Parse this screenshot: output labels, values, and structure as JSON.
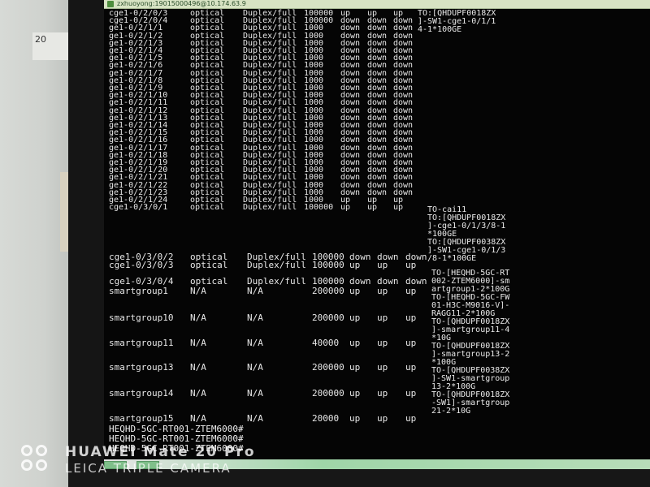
{
  "wall_note": "20",
  "window": {
    "title": "zxhuoyong:19015000496@10.174.63.9"
  },
  "terminal": {
    "rows": [
      {
        "port": "cge1-0/2/0/3",
        "type": "optical",
        "duplex": "Duplex/full",
        "speed": "100000",
        "admin": "up",
        "phy": "up",
        "proto": "up"
      },
      {
        "port": "cge1-0/2/0/4",
        "type": "optical",
        "duplex": "Duplex/full",
        "speed": "100000",
        "admin": "down",
        "phy": "down",
        "proto": "down"
      },
      {
        "port": "ge1-0/2/1/1",
        "type": "optical",
        "duplex": "Duplex/full",
        "speed": "1000",
        "admin": "down",
        "phy": "down",
        "proto": "down"
      },
      {
        "port": "ge1-0/2/1/2",
        "type": "optical",
        "duplex": "Duplex/full",
        "speed": "1000",
        "admin": "down",
        "phy": "down",
        "proto": "down"
      },
      {
        "port": "ge1-0/2/1/3",
        "type": "optical",
        "duplex": "Duplex/full",
        "speed": "1000",
        "admin": "down",
        "phy": "down",
        "proto": "down"
      },
      {
        "port": "ge1-0/2/1/4",
        "type": "optical",
        "duplex": "Duplex/full",
        "speed": "1000",
        "admin": "down",
        "phy": "down",
        "proto": "down"
      },
      {
        "port": "ge1-0/2/1/5",
        "type": "optical",
        "duplex": "Duplex/full",
        "speed": "1000",
        "admin": "down",
        "phy": "down",
        "proto": "down"
      },
      {
        "port": "ge1-0/2/1/6",
        "type": "optical",
        "duplex": "Duplex/full",
        "speed": "1000",
        "admin": "down",
        "phy": "down",
        "proto": "down"
      },
      {
        "port": "ge1-0/2/1/7",
        "type": "optical",
        "duplex": "Duplex/full",
        "speed": "1000",
        "admin": "down",
        "phy": "down",
        "proto": "down"
      },
      {
        "port": "ge1-0/2/1/8",
        "type": "optical",
        "duplex": "Duplex/full",
        "speed": "1000",
        "admin": "down",
        "phy": "down",
        "proto": "down"
      },
      {
        "port": "ge1-0/2/1/9",
        "type": "optical",
        "duplex": "Duplex/full",
        "speed": "1000",
        "admin": "down",
        "phy": "down",
        "proto": "down"
      },
      {
        "port": "ge1-0/2/1/10",
        "type": "optical",
        "duplex": "Duplex/full",
        "speed": "1000",
        "admin": "down",
        "phy": "down",
        "proto": "down"
      },
      {
        "port": "ge1-0/2/1/11",
        "type": "optical",
        "duplex": "Duplex/full",
        "speed": "1000",
        "admin": "down",
        "phy": "down",
        "proto": "down"
      },
      {
        "port": "ge1-0/2/1/12",
        "type": "optical",
        "duplex": "Duplex/full",
        "speed": "1000",
        "admin": "down",
        "phy": "down",
        "proto": "down"
      },
      {
        "port": "ge1-0/2/1/13",
        "type": "optical",
        "duplex": "Duplex/full",
        "speed": "1000",
        "admin": "down",
        "phy": "down",
        "proto": "down"
      },
      {
        "port": "ge1-0/2/1/14",
        "type": "optical",
        "duplex": "Duplex/full",
        "speed": "1000",
        "admin": "down",
        "phy": "down",
        "proto": "down"
      },
      {
        "port": "ge1-0/2/1/15",
        "type": "optical",
        "duplex": "Duplex/full",
        "speed": "1000",
        "admin": "down",
        "phy": "down",
        "proto": "down"
      },
      {
        "port": "ge1-0/2/1/16",
        "type": "optical",
        "duplex": "Duplex/full",
        "speed": "1000",
        "admin": "down",
        "phy": "down",
        "proto": "down"
      },
      {
        "port": "ge1-0/2/1/17",
        "type": "optical",
        "duplex": "Duplex/full",
        "speed": "1000",
        "admin": "down",
        "phy": "down",
        "proto": "down"
      },
      {
        "port": "ge1-0/2/1/18",
        "type": "optical",
        "duplex": "Duplex/full",
        "speed": "1000",
        "admin": "down",
        "phy": "down",
        "proto": "down"
      },
      {
        "port": "ge1-0/2/1/19",
        "type": "optical",
        "duplex": "Duplex/full",
        "speed": "1000",
        "admin": "down",
        "phy": "down",
        "proto": "down"
      },
      {
        "port": "ge1-0/2/1/20",
        "type": "optical",
        "duplex": "Duplex/full",
        "speed": "1000",
        "admin": "down",
        "phy": "down",
        "proto": "down"
      },
      {
        "port": "ge1-0/2/1/21",
        "type": "optical",
        "duplex": "Duplex/full",
        "speed": "1000",
        "admin": "down",
        "phy": "down",
        "proto": "down"
      },
      {
        "port": "ge1-0/2/1/22",
        "type": "optical",
        "duplex": "Duplex/full",
        "speed": "1000",
        "admin": "down",
        "phy": "down",
        "proto": "down"
      },
      {
        "port": "ge1-0/2/1/23",
        "type": "optical",
        "duplex": "Duplex/full",
        "speed": "1000",
        "admin": "down",
        "phy": "down",
        "proto": "down"
      },
      {
        "port": "ge1-0/2/1/24",
        "type": "optical",
        "duplex": "Duplex/full",
        "speed": "1000",
        "admin": "up",
        "phy": "up",
        "proto": "up"
      },
      {
        "port": "cge1-0/3/0/1",
        "type": "optical",
        "duplex": "Duplex/full",
        "speed": "100000",
        "admin": "up",
        "phy": "up",
        "proto": "up"
      },
      {
        "port": "cge1-0/3/0/2",
        "type": "optical",
        "duplex": "Duplex/full",
        "speed": "100000",
        "admin": "down",
        "phy": "down",
        "proto": "down"
      },
      {
        "port": "cge1-0/3/0/3",
        "type": "optical",
        "duplex": "Duplex/full",
        "speed": "100000",
        "admin": "up",
        "phy": "up",
        "proto": "up"
      },
      {
        "port": "cge1-0/3/0/4",
        "type": "optical",
        "duplex": "Duplex/full",
        "speed": "100000",
        "admin": "down",
        "phy": "down",
        "proto": "down"
      },
      {
        "port": "smartgroup1",
        "type": "N/A",
        "duplex": "N/A",
        "speed": "200000",
        "admin": "up",
        "phy": "up",
        "proto": "up"
      },
      {
        "port": "smartgroup10",
        "type": "N/A",
        "duplex": "N/A",
        "speed": "200000",
        "admin": "up",
        "phy": "up",
        "proto": "up"
      },
      {
        "port": "smartgroup11",
        "type": "N/A",
        "duplex": "N/A",
        "speed": "40000",
        "admin": "up",
        "phy": "up",
        "proto": "up"
      },
      {
        "port": "smartgroup13",
        "type": "N/A",
        "duplex": "N/A",
        "speed": "200000",
        "admin": "up",
        "phy": "up",
        "proto": "up"
      },
      {
        "port": "smartgroup14",
        "type": "N/A",
        "duplex": "N/A",
        "speed": "200000",
        "admin": "up",
        "phy": "up",
        "proto": "up"
      },
      {
        "port": "smartgroup15",
        "type": "N/A",
        "duplex": "N/A",
        "speed": "20000",
        "admin": "up",
        "phy": "up",
        "proto": "up"
      }
    ],
    "remarks": [
      "TO:[QHDUPF0018ZX\n]-SW1-cge1-0/1/1\n4-1*100GE",
      "TO-cai11\nTO:[QHDUPF0018ZX\n]-cge1-0/1/3/8-1\n*100GE",
      "TO:[QHDUPF0038ZX\n]-SW1-cge1-0/1/3\n/8-1*100GE",
      "TO-[HEQHD-5GC-RT\n002-ZTEM6000]-sm\nartgroup1-2*100G\nTO-[HEQHD-5GC-FW\n01-H3C-M9016-V]-\nRAGG11-2*100G\nTO-[QHDUPF0018ZX\n]-smartgroup11-4\n*10G\nTO-[QHDUPF0018ZX\n]-smartgroup13-2\n*100G\nTO-[QHDUPF0038ZX\n]-SW1-smartgroup\n13-2*100G\nTO-[QHDUPF0018ZX\n-SW1]-smartgroup\n21-2*10G"
    ],
    "prompts": [
      "HEQHD-5GC-RT001-ZTEM6000#",
      "HEQHD-5GC-RT001-ZTEM6000#",
      "HEQHD-5GC-RT001-ZTEM6000#"
    ]
  },
  "watermark": {
    "line1": "HUAWEI Mate 20 Pro",
    "line2": "LEICA TRIPLE CAMERA"
  }
}
